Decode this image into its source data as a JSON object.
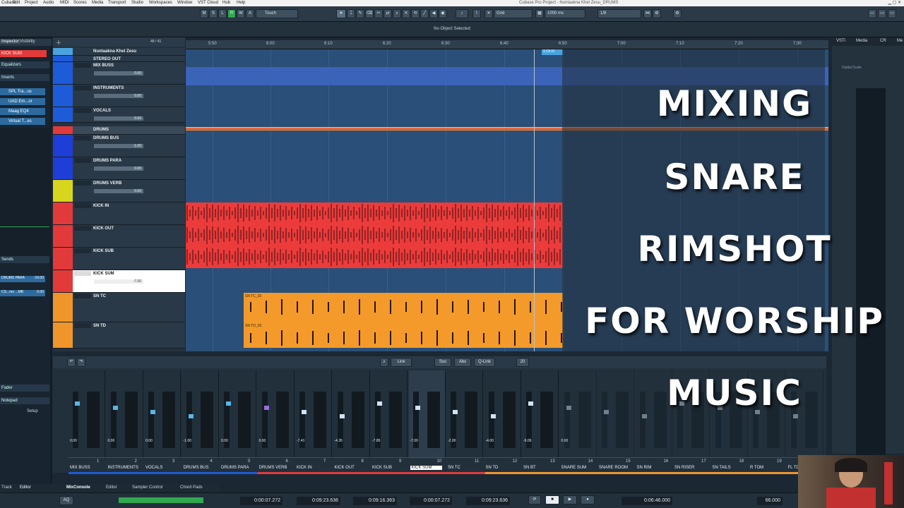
{
  "menubar": {
    "items": [
      "Cubase",
      "Edit",
      "Project",
      "Audio",
      "MIDI",
      "Scores",
      "Media",
      "Transport",
      "Studio",
      "Workspaces",
      "Window",
      "VST Cloud",
      "Hub",
      "Help"
    ],
    "window_title": "Cubase Pro Project - Nuntaakna Khel Zesu_DRUMS"
  },
  "toolbar": {
    "mode_buttons": [
      "M",
      "S",
      "L",
      "R",
      "W",
      "A"
    ],
    "automation_mode": "Touch",
    "snap_type": "Grid",
    "grid_value": "1000 ms",
    "quantize": "1/8"
  },
  "infoline": {
    "status": "No Object Selected"
  },
  "inspector": {
    "tabs": [
      "Inspector",
      "Visibility"
    ],
    "track_name": "KICK SUM",
    "sections": [
      "Equalizers",
      "Inserts"
    ],
    "inserts": [
      "SPL Tra...us",
      "UAD Em...or",
      "Maag EQ4",
      "Virtual T...es"
    ],
    "sends_label": "Sends",
    "sends": [
      {
        "name": "DRUMS PARA",
        "value": "-10.00"
      },
      {
        "name": "CS...mo ...MB",
        "value": "0.00"
      }
    ],
    "fader_label": "Fader",
    "notepad_label": "Notepad",
    "setup_label": "Setup"
  },
  "tracklist": {
    "header_count": "48 / 41",
    "tracks": [
      {
        "name": "Nuntaakna Khel Zesu",
        "color": "#4aa3df",
        "vol": ""
      },
      {
        "name": "STEREO OUT",
        "color": "#1e5bd8",
        "vol": ""
      },
      {
        "name": "MIX BUSS",
        "color": "#1e5bd8",
        "vol": "0.00"
      },
      {
        "name": "INSTRUMENTS",
        "color": "#1e5bd8",
        "vol": "0.00"
      },
      {
        "name": "VOCALS",
        "color": "#1e5bd8",
        "vol": "0.00"
      },
      {
        "name": "DRUMS",
        "color": "#e23a3a",
        "vol": ""
      },
      {
        "name": "DRUMS BUS",
        "color": "#1e3ed8",
        "vol": "-1.00"
      },
      {
        "name": "DRUMS PARA",
        "color": "#1e3ed8",
        "vol": "0.00"
      },
      {
        "name": "DRUMS VERB",
        "color": "#d6d61e",
        "vol": "0.00"
      },
      {
        "name": "KICK IN",
        "color": "#e23a3a",
        "vol": ""
      },
      {
        "name": "KICK OUT",
        "color": "#e23a3a",
        "vol": ""
      },
      {
        "name": "KICK SUB",
        "color": "#e23a3a",
        "vol": ""
      },
      {
        "name": "KICK SUM",
        "color": "#e23a3a",
        "vol": "-7.00"
      },
      {
        "name": "SN TC",
        "color": "#f0952a",
        "vol": ""
      },
      {
        "name": "SN TD",
        "color": "#f0952a",
        "vol": ""
      }
    ]
  },
  "ruler": {
    "ticks": [
      "5:50",
      "6:00",
      "6:10",
      "6:20",
      "6:30",
      "6:40",
      "6:50",
      "7:00",
      "7:10",
      "7:20",
      "7:30"
    ],
    "locator": "1 Ch Fi"
  },
  "clips": {
    "sn_tc": "SN TC_02",
    "sn_td": "SN TD_02"
  },
  "mixer": {
    "toolbar": [
      "Link",
      "Sus",
      "Abs",
      "Q-Link",
      "20"
    ],
    "channels": [
      {
        "num": "1",
        "name": "MIX BUSS"
      },
      {
        "num": "2",
        "name": "INSTRUMENTS"
      },
      {
        "num": "3",
        "name": "VOCALS"
      },
      {
        "num": "4",
        "name": "DRUMS BUS"
      },
      {
        "num": "5",
        "name": "DRUMS PARA"
      },
      {
        "num": "6",
        "name": "DRUMS VERB"
      },
      {
        "num": "7",
        "name": "KICK IN"
      },
      {
        "num": "8",
        "name": "KICK OUT"
      },
      {
        "num": "9",
        "name": "KICK SUB"
      },
      {
        "num": "10",
        "name": "KICK SUM"
      },
      {
        "num": "11",
        "name": "SN TC"
      },
      {
        "num": "12",
        "name": "SN TD"
      },
      {
        "num": "13",
        "name": "SN BT"
      },
      {
        "num": "14",
        "name": "SNARE SUM"
      },
      {
        "num": "15",
        "name": "SNARE ROOM"
      },
      {
        "num": "16",
        "name": "SN RIM"
      },
      {
        "num": "17",
        "name": "SN RISER"
      },
      {
        "num": "18",
        "name": "SN TAILS"
      },
      {
        "num": "19",
        "name": "R TOM"
      },
      {
        "num": "20",
        "name": "FL TO"
      }
    ],
    "values": [
      "0.00",
      "0.00",
      "0.00",
      "-1.00",
      "0.00",
      "0.00",
      "-7.41",
      "-4.26",
      "-7.85",
      "-7.00",
      "-2.00",
      "-4.00",
      "-9.09",
      "0.00"
    ]
  },
  "vsti": {
    "tabs": [
      "VSTi",
      "Media",
      "CR",
      "Me"
    ],
    "label": "Digital Scale"
  },
  "bottom_tabs": [
    "Track",
    "Editor",
    "MixConsole",
    "Editor",
    "Sampler Control",
    "Chord Pads"
  ],
  "transport": {
    "left_locator": "0:00:07.272",
    "right_locator": "0:09:23.636",
    "length": "0:09:16.363",
    "punch_in": "0:00:07.272",
    "punch_out": "0:09:23.636",
    "position": "0:06:46.000",
    "tempo": "66.000",
    "aq": "AQ"
  },
  "title": {
    "line1": "MIXING",
    "line2": "SNARE",
    "line3": "RIMSHOT",
    "line4": "FOR WORSHIP",
    "line5": "MUSIC"
  },
  "colors": {
    "accent": "#58b6e8",
    "kick": "#e23a3a",
    "snare": "#f0952a",
    "bg": "#1b2834"
  }
}
